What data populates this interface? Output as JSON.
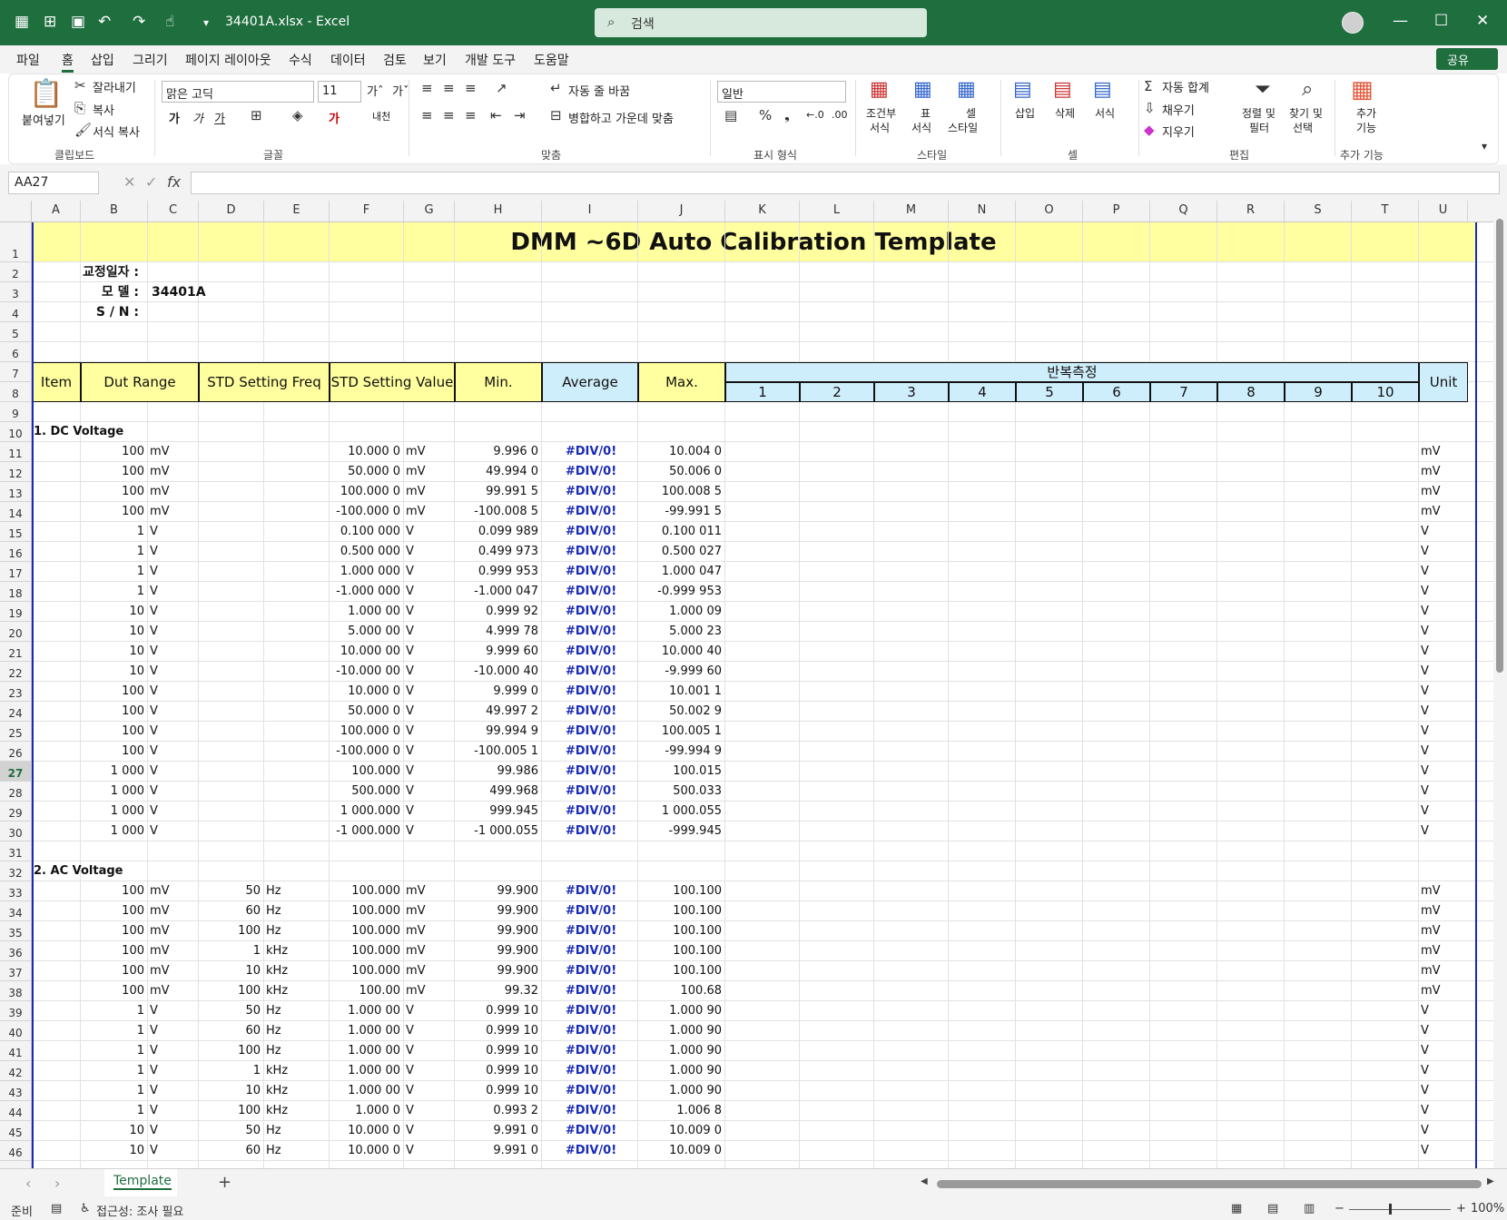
{
  "titlebar": {
    "filename": "34401A.xlsx  -  Excel",
    "search_placeholder": "검색"
  },
  "menu": [
    "파일",
    "홈",
    "삽입",
    "그리기",
    "페이지 레이아웃",
    "수식",
    "데이터",
    "검토",
    "보기",
    "개발 도구",
    "도움말"
  ],
  "share_label": "공유",
  "ribbon": {
    "paste": "붙여넣기",
    "cut": "잘라내기",
    "copy": "복사",
    "format_painter": "서식 복사",
    "group_clipboard": "클립보드",
    "font_name": "맑은 고딕",
    "font_size": "11",
    "group_font": "글꼴",
    "wrap": "자동 줄 바꿈",
    "merge": "병합하고 가운데 맞춤",
    "group_align": "맞춤",
    "number_format": "일반",
    "group_number": "표시 형식",
    "cond_format_1": "조건부",
    "cond_format_2": "서식",
    "table_fmt_1": "표",
    "table_fmt_2": "서식",
    "cell_style_1": "셀",
    "cell_style_2": "스타일",
    "group_styles": "스타일",
    "insert": "삽입",
    "delete": "삭제",
    "format": "서식",
    "group_cells": "셀",
    "autosum": "자동 합계",
    "fill": "채우기",
    "clear": "지우기",
    "sort_1": "정렬 및",
    "sort_2": "필터",
    "find_1": "찾기 및",
    "find_2": "선택",
    "group_edit": "편집",
    "addins_1": "추가",
    "addins_2": "기능",
    "group_addins": "추가 기능"
  },
  "namebox": "AA27",
  "columns": [
    "A",
    "B",
    "C",
    "D",
    "E",
    "F",
    "G",
    "H",
    "I",
    "J",
    "K",
    "L",
    "M",
    "N",
    "O",
    "P",
    "Q",
    "R",
    "S",
    "T",
    "U"
  ],
  "sheet": {
    "title": "DMM ~6D Auto Calibration Template",
    "info": [
      {
        "label": "교정일자 :",
        "value": ""
      },
      {
        "label": "모       델 :",
        "value": "34401A"
      },
      {
        "label": "S   /   N :",
        "value": ""
      }
    ],
    "headers": {
      "item": "Item",
      "dut": "Dut Range",
      "freq": "STD Setting Freq",
      "value": "STD Setting Value",
      "min": "Min.",
      "avg": "Average",
      "max": "Max.",
      "repeat": "반복측정",
      "unit": "Unit",
      "reps": [
        "1",
        "2",
        "3",
        "4",
        "5",
        "6",
        "7",
        "8",
        "9",
        "10"
      ]
    },
    "section_dc": "1. DC Voltage",
    "section_ac": "2. AC Voltage",
    "dc_rows": [
      [
        "100",
        "mV",
        "",
        "",
        "10.000 0",
        "mV",
        "9.996 0",
        "#DIV/0!",
        "10.004 0",
        "mV"
      ],
      [
        "100",
        "mV",
        "",
        "",
        "50.000 0",
        "mV",
        "49.994 0",
        "#DIV/0!",
        "50.006 0",
        "mV"
      ],
      [
        "100",
        "mV",
        "",
        "",
        "100.000 0",
        "mV",
        "99.991 5",
        "#DIV/0!",
        "100.008 5",
        "mV"
      ],
      [
        "100",
        "mV",
        "",
        "",
        "-100.000 0",
        "mV",
        "-100.008 5",
        "#DIV/0!",
        "-99.991 5",
        "mV"
      ],
      [
        "1",
        "V",
        "",
        "",
        "0.100 000",
        "V",
        "0.099 989",
        "#DIV/0!",
        "0.100 011",
        "V"
      ],
      [
        "1",
        "V",
        "",
        "",
        "0.500 000",
        "V",
        "0.499 973",
        "#DIV/0!",
        "0.500 027",
        "V"
      ],
      [
        "1",
        "V",
        "",
        "",
        "1.000 000",
        "V",
        "0.999 953",
        "#DIV/0!",
        "1.000 047",
        "V"
      ],
      [
        "1",
        "V",
        "",
        "",
        "-1.000 000",
        "V",
        "-1.000 047",
        "#DIV/0!",
        "-0.999 953",
        "V"
      ],
      [
        "10",
        "V",
        "",
        "",
        "1.000 00",
        "V",
        "0.999 92",
        "#DIV/0!",
        "1.000 09",
        "V"
      ],
      [
        "10",
        "V",
        "",
        "",
        "5.000 00",
        "V",
        "4.999 78",
        "#DIV/0!",
        "5.000 23",
        "V"
      ],
      [
        "10",
        "V",
        "",
        "",
        "10.000 00",
        "V",
        "9.999 60",
        "#DIV/0!",
        "10.000 40",
        "V"
      ],
      [
        "10",
        "V",
        "",
        "",
        "-10.000 00",
        "V",
        "-10.000 40",
        "#DIV/0!",
        "-9.999 60",
        "V"
      ],
      [
        "100",
        "V",
        "",
        "",
        "10.000 0",
        "V",
        "9.999 0",
        "#DIV/0!",
        "10.001 1",
        "V"
      ],
      [
        "100",
        "V",
        "",
        "",
        "50.000 0",
        "V",
        "49.997 2",
        "#DIV/0!",
        "50.002 9",
        "V"
      ],
      [
        "100",
        "V",
        "",
        "",
        "100.000 0",
        "V",
        "99.994 9",
        "#DIV/0!",
        "100.005 1",
        "V"
      ],
      [
        "100",
        "V",
        "",
        "",
        "-100.000 0",
        "V",
        "-100.005 1",
        "#DIV/0!",
        "-99.994 9",
        "V"
      ],
      [
        "1 000",
        "V",
        "",
        "",
        "100.000",
        "V",
        "99.986",
        "#DIV/0!",
        "100.015",
        "V"
      ],
      [
        "1 000",
        "V",
        "",
        "",
        "500.000",
        "V",
        "499.968",
        "#DIV/0!",
        "500.033",
        "V"
      ],
      [
        "1 000",
        "V",
        "",
        "",
        "1 000.000",
        "V",
        "999.945",
        "#DIV/0!",
        "1 000.055",
        "V"
      ],
      [
        "1 000",
        "V",
        "",
        "",
        "-1 000.000",
        "V",
        "-1 000.055",
        "#DIV/0!",
        "-999.945",
        "V"
      ]
    ],
    "ac_rows": [
      [
        "100",
        "mV",
        "50",
        "Hz",
        "100.000",
        "mV",
        "99.900",
        "#DIV/0!",
        "100.100",
        "mV"
      ],
      [
        "100",
        "mV",
        "60",
        "Hz",
        "100.000",
        "mV",
        "99.900",
        "#DIV/0!",
        "100.100",
        "mV"
      ],
      [
        "100",
        "mV",
        "100",
        "Hz",
        "100.000",
        "mV",
        "99.900",
        "#DIV/0!",
        "100.100",
        "mV"
      ],
      [
        "100",
        "mV",
        "1",
        "kHz",
        "100.000",
        "mV",
        "99.900",
        "#DIV/0!",
        "100.100",
        "mV"
      ],
      [
        "100",
        "mV",
        "10",
        "kHz",
        "100.000",
        "mV",
        "99.900",
        "#DIV/0!",
        "100.100",
        "mV"
      ],
      [
        "100",
        "mV",
        "100",
        "kHz",
        "100.00",
        "mV",
        "99.32",
        "#DIV/0!",
        "100.68",
        "mV"
      ],
      [
        "1",
        "V",
        "50",
        "Hz",
        "1.000 00",
        "V",
        "0.999 10",
        "#DIV/0!",
        "1.000 90",
        "V"
      ],
      [
        "1",
        "V",
        "60",
        "Hz",
        "1.000 00",
        "V",
        "0.999 10",
        "#DIV/0!",
        "1.000 90",
        "V"
      ],
      [
        "1",
        "V",
        "100",
        "Hz",
        "1.000 00",
        "V",
        "0.999 10",
        "#DIV/0!",
        "1.000 90",
        "V"
      ],
      [
        "1",
        "V",
        "1",
        "kHz",
        "1.000 00",
        "V",
        "0.999 10",
        "#DIV/0!",
        "1.000 90",
        "V"
      ],
      [
        "1",
        "V",
        "10",
        "kHz",
        "1.000 00",
        "V",
        "0.999 10",
        "#DIV/0!",
        "1.000 90",
        "V"
      ],
      [
        "1",
        "V",
        "100",
        "kHz",
        "1.000 0",
        "V",
        "0.993 2",
        "#DIV/0!",
        "1.006 8",
        "V"
      ],
      [
        "10",
        "V",
        "50",
        "Hz",
        "10.000 0",
        "V",
        "9.991 0",
        "#DIV/0!",
        "10.009 0",
        "V"
      ],
      [
        "10",
        "V",
        "60",
        "Hz",
        "10.000 0",
        "V",
        "9.991 0",
        "#DIV/0!",
        "10.009 0",
        "V"
      ]
    ]
  },
  "sheet_tab": "Template",
  "status": {
    "ready": "준비",
    "accessibility": "접근성: 조사 필요",
    "zoom": "100%"
  },
  "colors": {
    "excel_green": "#1e6e3e",
    "yellow": "#ffff9f",
    "light_blue": "#cfeefc",
    "error_blue": "#1a2bb8"
  }
}
